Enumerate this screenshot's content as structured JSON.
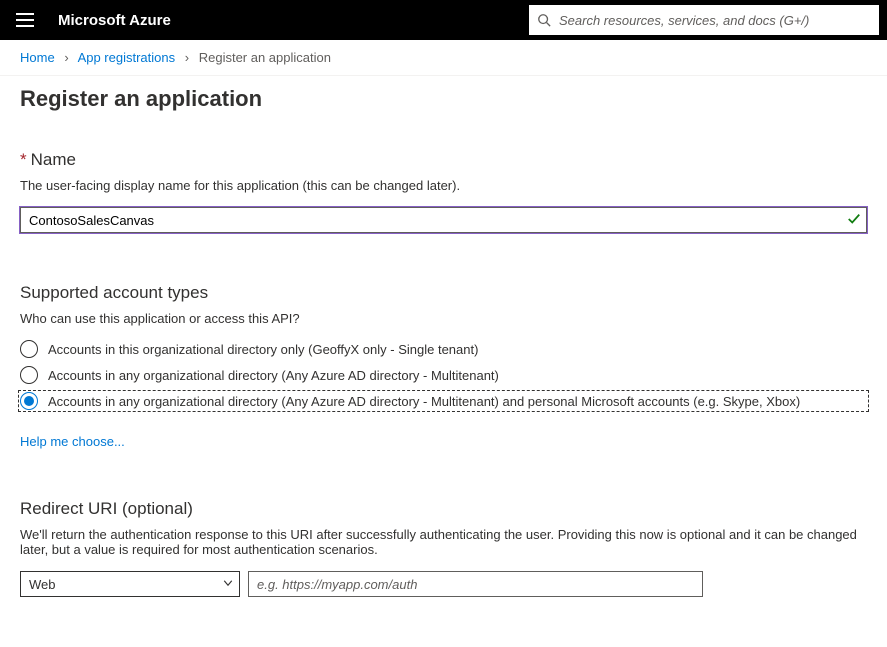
{
  "topbar": {
    "brand": "Microsoft Azure",
    "search_placeholder": "Search resources, services, and docs (G+/)"
  },
  "breadcrumb": {
    "items": [
      "Home",
      "App registrations",
      "Register an application"
    ]
  },
  "page": {
    "title": "Register an application"
  },
  "name_section": {
    "heading": "Name",
    "helper": "The user-facing display name for this application (this can be changed later).",
    "value": "ContosoSalesCanvas"
  },
  "account_types": {
    "heading": "Supported account types",
    "helper": "Who can use this application or access this API?",
    "options": [
      "Accounts in this organizational directory only (GeoffyX only - Single tenant)",
      "Accounts in any organizational directory (Any Azure AD directory - Multitenant)",
      "Accounts in any organizational directory (Any Azure AD directory - Multitenant) and personal Microsoft accounts (e.g. Skype, Xbox)"
    ],
    "selected_index": 2,
    "help_link": "Help me choose..."
  },
  "redirect": {
    "heading": "Redirect URI (optional)",
    "helper": "We'll return the authentication response to this URI after successfully authenticating the user. Providing this now is optional and it can be changed later, but a value is required for most authentication scenarios.",
    "platform_value": "Web",
    "uri_placeholder": "e.g. https://myapp.com/auth"
  }
}
